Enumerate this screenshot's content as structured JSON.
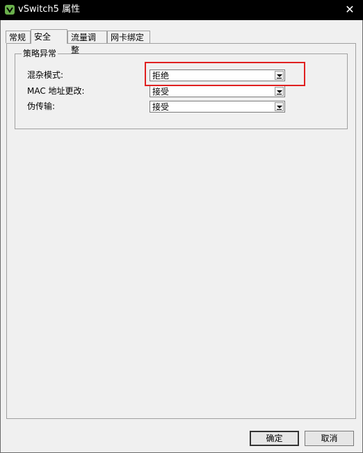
{
  "window": {
    "title": "vSwitch5 属性",
    "close_glyph": "✕"
  },
  "tabs": [
    {
      "label": "常规"
    },
    {
      "label": "安全"
    },
    {
      "label": "流量调整"
    },
    {
      "label": "网卡绑定"
    }
  ],
  "active_tab": "安全",
  "group": {
    "title": "策略异常",
    "rows": [
      {
        "label": "混杂模式:",
        "value": "拒绝"
      },
      {
        "label": "MAC 地址更改:",
        "value": "接受"
      },
      {
        "label": "伪传输:",
        "value": "接受"
      }
    ]
  },
  "buttons": {
    "ok": "确定",
    "cancel": "取消"
  },
  "colors": {
    "titlebar": "#000000",
    "highlight": "#e02020",
    "background": "#f0f0f0"
  }
}
